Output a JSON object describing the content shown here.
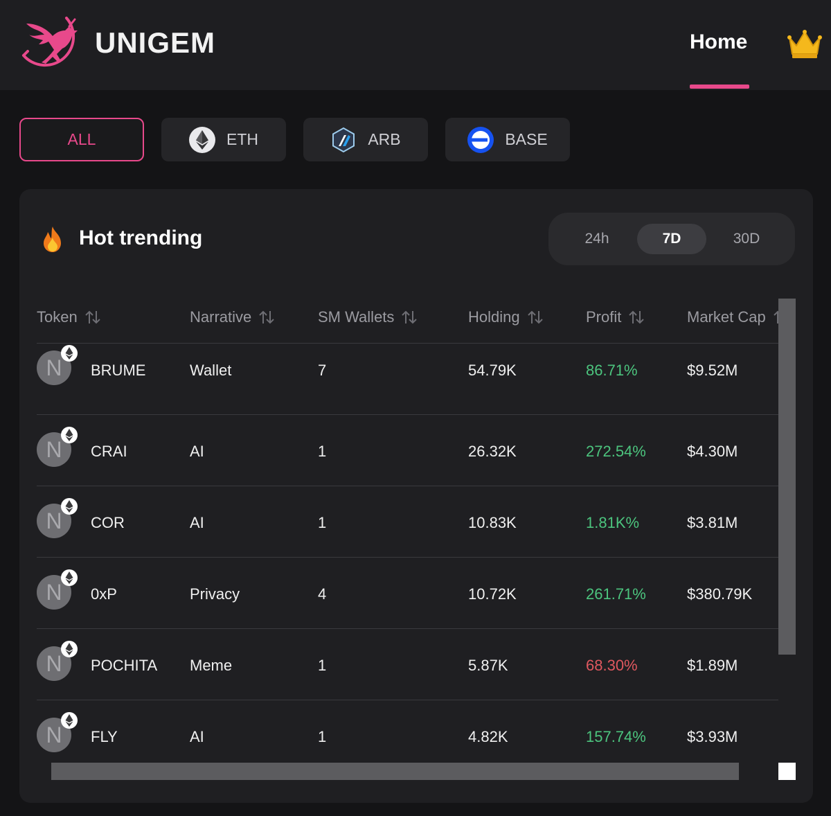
{
  "brand": {
    "name": "UNIGEM",
    "logo_icon": "pegasus-logo-icon",
    "accent": "#e8498b"
  },
  "nav": {
    "home_label": "Home",
    "crown_icon": "crown-icon"
  },
  "filters": [
    {
      "label": "ALL",
      "icon": "",
      "active": true
    },
    {
      "label": "ETH",
      "icon": "ethereum-icon",
      "active": false
    },
    {
      "label": "ARB",
      "icon": "arbitrum-icon",
      "active": false
    },
    {
      "label": "BASE",
      "icon": "base-icon",
      "active": false
    }
  ],
  "trending": {
    "title": "Hot trending",
    "icon": "fire-icon",
    "ranges": [
      "24h",
      "7D",
      "30D"
    ],
    "active_range": "7D",
    "columns": [
      "Token",
      "Narrative",
      "SM Wallets",
      "Holding",
      "Profit",
      "Market Cap"
    ],
    "rows": [
      {
        "avatar": "N",
        "token": "BRUME",
        "narrative": "Wallet",
        "sm_wallets": "7",
        "holding": "54.79K",
        "profit": "86.71%",
        "profit_dir": "up",
        "market_cap": "$9.52M"
      },
      {
        "avatar": "N",
        "token": "CRAI",
        "narrative": "AI",
        "sm_wallets": "1",
        "holding": "26.32K",
        "profit": "272.54%",
        "profit_dir": "up",
        "market_cap": "$4.30M"
      },
      {
        "avatar": "N",
        "token": "COR",
        "narrative": "AI",
        "sm_wallets": "1",
        "holding": "10.83K",
        "profit": "1.81K%",
        "profit_dir": "up",
        "market_cap": "$3.81M"
      },
      {
        "avatar": "N",
        "token": "0xP",
        "narrative": "Privacy",
        "sm_wallets": "4",
        "holding": "10.72K",
        "profit": "261.71%",
        "profit_dir": "up",
        "market_cap": "$380.79K"
      },
      {
        "avatar": "N",
        "token": "POCHITA",
        "narrative": "Meme",
        "sm_wallets": "1",
        "holding": "5.87K",
        "profit": "68.30%",
        "profit_dir": "down",
        "market_cap": "$1.89M"
      },
      {
        "avatar": "N",
        "token": "FLY",
        "narrative": "AI",
        "sm_wallets": "1",
        "holding": "4.82K",
        "profit": "157.74%",
        "profit_dir": "up",
        "market_cap": "$3.93M"
      }
    ]
  }
}
